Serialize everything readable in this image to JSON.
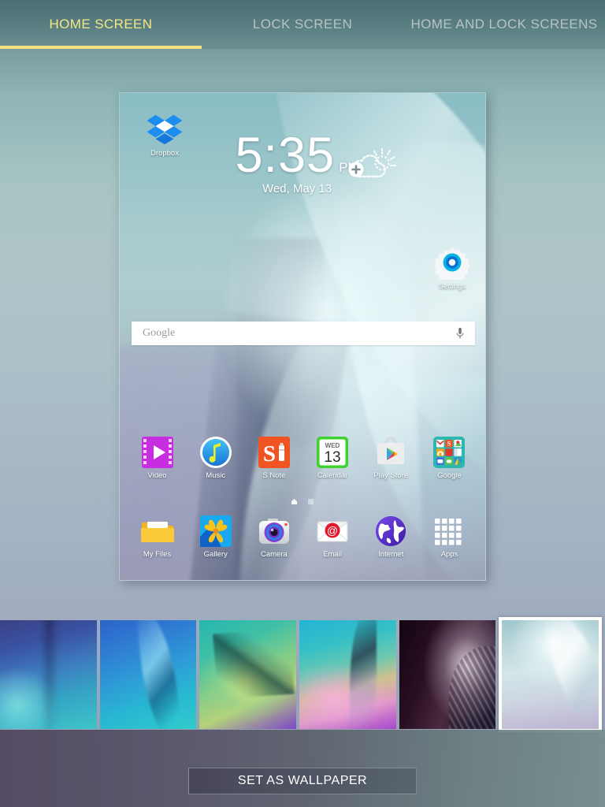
{
  "tabs": [
    {
      "id": "home-screen",
      "label": "HOME SCREEN",
      "active": true
    },
    {
      "id": "lock-screen",
      "label": "LOCK SCREEN",
      "active": false
    },
    {
      "id": "home-and-lock-screens",
      "label": "HOME AND LOCK SCREENS",
      "active": false
    }
  ],
  "colors": {
    "tab_active": "#f5e884",
    "tab_inactive": "#b6c4c4",
    "tab_underline": "#f2e17c",
    "selection_border": "#ffffff"
  },
  "preview": {
    "clock": {
      "time": "5:35",
      "ampm": "PM",
      "date": "Wed, May 13"
    },
    "weather_widget": {
      "icon": "add-weather-placeholder-icon",
      "label": ""
    },
    "top_shortcut": {
      "label": "Dropbox",
      "icon": "dropbox-icon"
    },
    "settings_shortcut": {
      "label": "Settings",
      "icon": "gear-icon"
    },
    "search": {
      "placeholder": "Google",
      "mic_icon": "microphone-icon"
    },
    "page_indicator": {
      "count": 2,
      "current": 1
    },
    "app_rows": [
      [
        {
          "label": "Video",
          "icon": "video-player-icon"
        },
        {
          "label": "Music",
          "icon": "music-note-icon"
        },
        {
          "label": "S Note",
          "icon": "s-note-icon"
        },
        {
          "label": "Calendar",
          "icon": "calendar-icon",
          "day_name": "WED",
          "day_number": "13"
        },
        {
          "label": "Play Store",
          "icon": "play-store-icon"
        },
        {
          "label": "Google",
          "icon": "google-folder-icon"
        }
      ],
      [
        {
          "label": "My Files",
          "icon": "folder-icon"
        },
        {
          "label": "Gallery",
          "icon": "gallery-icon"
        },
        {
          "label": "Camera",
          "icon": "camera-icon"
        },
        {
          "label": "Email",
          "icon": "email-icon"
        },
        {
          "label": "Internet",
          "icon": "globe-icon"
        },
        {
          "label": "Apps",
          "icon": "apps-grid-icon"
        }
      ]
    ]
  },
  "thumbnails": [
    {
      "id": "wallpaper-1",
      "name": "indigo-cyan-curve",
      "selected": false
    },
    {
      "id": "wallpaper-2",
      "name": "blue-ribbon",
      "selected": false
    },
    {
      "id": "wallpaper-3",
      "name": "green-smoke",
      "selected": false
    },
    {
      "id": "wallpaper-4",
      "name": "pastel-ribbon",
      "selected": false
    },
    {
      "id": "wallpaper-5",
      "name": "dark-feather",
      "selected": false
    },
    {
      "id": "wallpaper-6",
      "name": "light-teal-petals",
      "selected": true
    }
  ],
  "footer": {
    "set_wallpaper_label": "SET AS WALLPAPER"
  }
}
